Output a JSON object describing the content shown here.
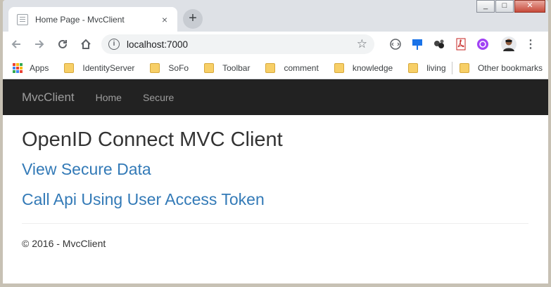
{
  "tab": {
    "title": "Home Page - MvcClient",
    "close": "×",
    "new_tab": "+"
  },
  "window": {
    "minimize": "_",
    "maximize": "□",
    "close": "✕"
  },
  "toolbar": {
    "url": "localhost:7000",
    "info": "i",
    "star": "☆",
    "menu": "⋮"
  },
  "bookmarks": {
    "apps": "Apps",
    "items": [
      "IdentityServer",
      "SoFo",
      "Toolbar",
      "comment",
      "knowledge",
      "living"
    ],
    "other": "Other bookmarks"
  },
  "site": {
    "brand": "MvcClient",
    "nav": [
      "Home",
      "Secure"
    ],
    "heading": "OpenID Connect MVC Client",
    "links": [
      "View Secure Data",
      "Call Api Using User Access Token"
    ],
    "footer": "© 2016 - MvcClient"
  },
  "icons": [
    "back-icon",
    "forward-icon",
    "reload-icon",
    "home-icon",
    "info-icon",
    "star-icon",
    "code-icon",
    "pin-icon",
    "balls-icon",
    "pdf-icon",
    "api-icon",
    "avatar",
    "menu-icon",
    "apps-icon",
    "folder-icon"
  ]
}
